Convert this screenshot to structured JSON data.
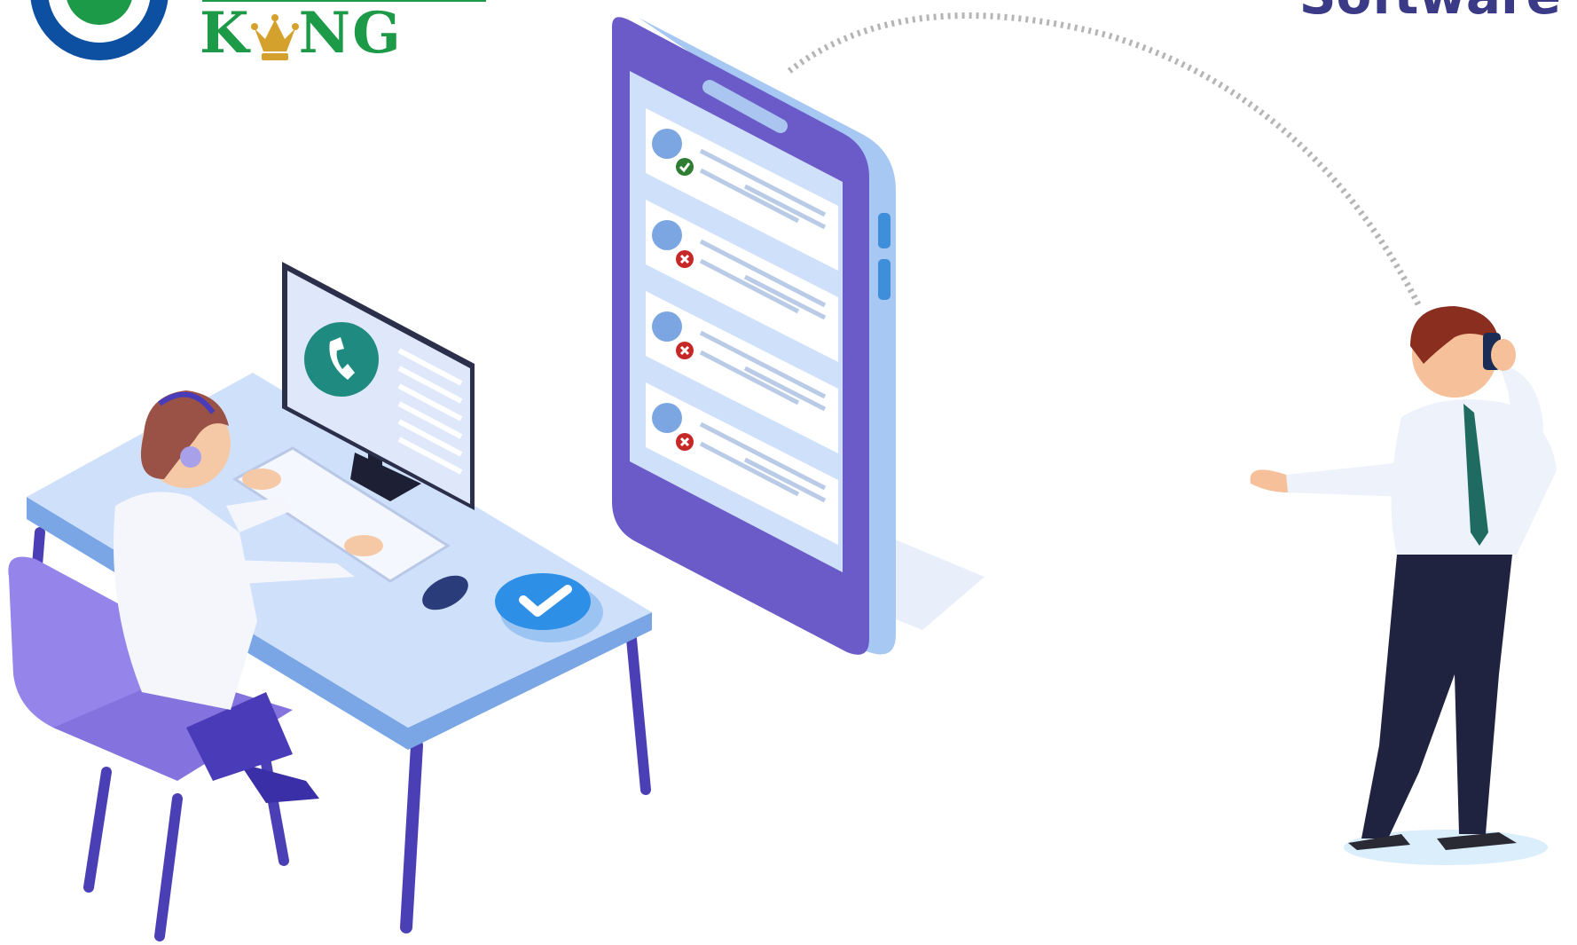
{
  "logo": {
    "wordmark": "KING",
    "brand_colors": {
      "ring": "#0d4fa0",
      "wordmark": "#1d9a47",
      "crown": "#d4a12c"
    }
  },
  "headline": {
    "text": "Software",
    "color": "#3b3a86"
  },
  "phone": {
    "list": [
      {
        "status": "check-icon",
        "status_color": "#2e7d32"
      },
      {
        "status": "cross-icon",
        "status_color": "#c62828"
      },
      {
        "status": "cross-icon",
        "status_color": "#c62828"
      },
      {
        "status": "cross-icon",
        "status_color": "#c62828"
      }
    ]
  },
  "colors": {
    "primary_purple": "#6b5bc9",
    "light_blue": "#cfe0fb",
    "accent_teal": "#1f8a80",
    "confirm_blue": "#2d8fe6",
    "dark_suit": "#1f2340"
  },
  "icons": [
    "phone-icon",
    "check-icon",
    "cross-icon",
    "crown-icon",
    "headset-icon"
  ]
}
